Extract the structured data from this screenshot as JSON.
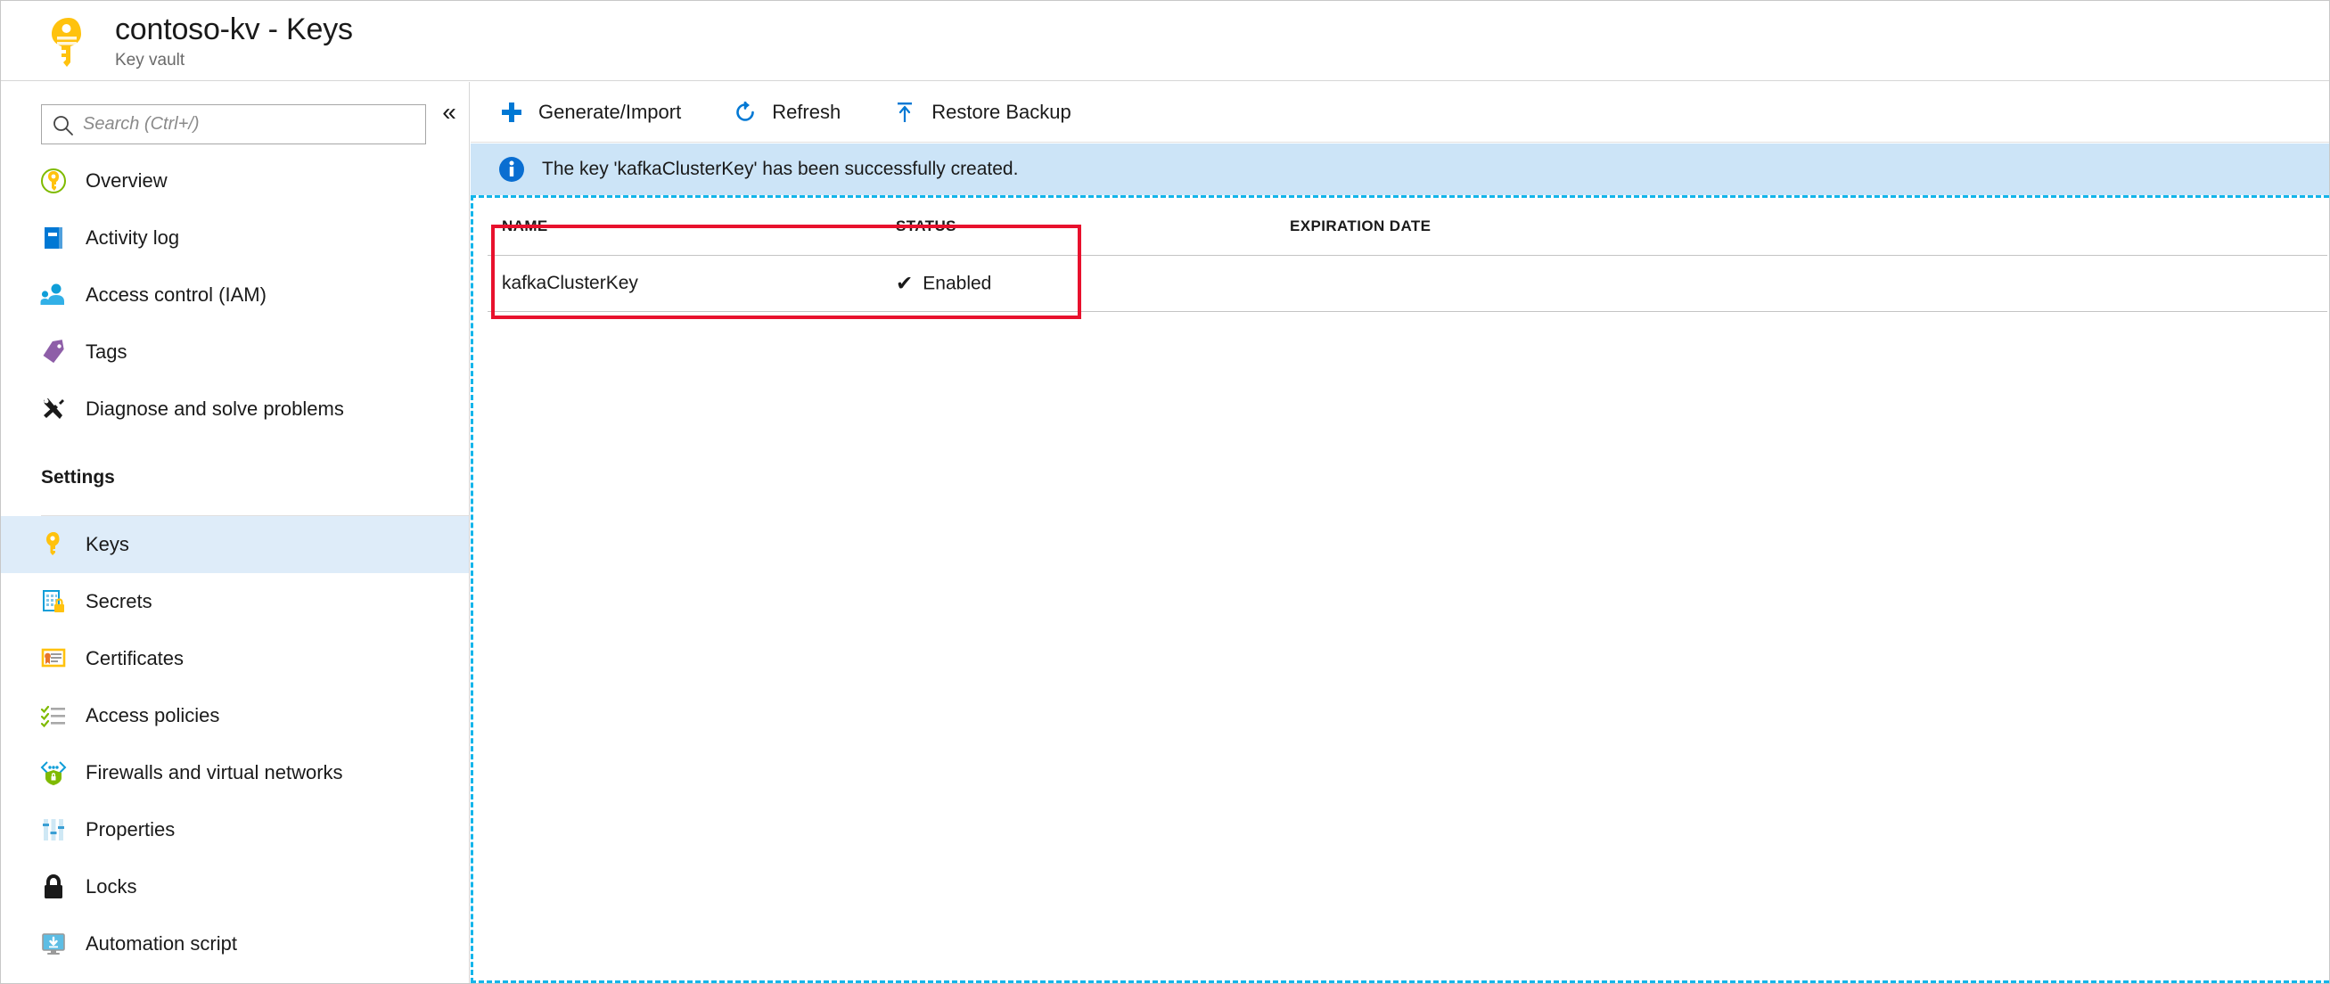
{
  "header": {
    "icon": "key-vault-icon",
    "title": "contoso-kv - Keys",
    "subtitle": "Key vault"
  },
  "sidebar": {
    "search": {
      "icon": "search-icon",
      "placeholder": "Search (Ctrl+/)",
      "value": ""
    },
    "collapse": {
      "icon": "chevron-double-left-icon",
      "glyph": "«"
    },
    "items": [
      {
        "label": "Overview",
        "icon": "overview-key-icon",
        "selected": false
      },
      {
        "label": "Activity log",
        "icon": "activity-log-icon",
        "selected": false
      },
      {
        "label": "Access control (IAM)",
        "icon": "access-control-icon",
        "selected": false
      },
      {
        "label": "Tags",
        "icon": "tags-icon",
        "selected": false
      },
      {
        "label": "Diagnose and solve problems",
        "icon": "diagnose-icon",
        "selected": false
      }
    ],
    "section_label": "Settings",
    "settings_items": [
      {
        "label": "Keys",
        "icon": "keys-icon",
        "selected": true
      },
      {
        "label": "Secrets",
        "icon": "secrets-icon",
        "selected": false
      },
      {
        "label": "Certificates",
        "icon": "certificates-icon",
        "selected": false
      },
      {
        "label": "Access policies",
        "icon": "access-policies-icon",
        "selected": false
      },
      {
        "label": "Firewalls and virtual networks",
        "icon": "firewall-icon",
        "selected": false
      },
      {
        "label": "Properties",
        "icon": "properties-icon",
        "selected": false
      },
      {
        "label": "Locks",
        "icon": "locks-icon",
        "selected": false
      },
      {
        "label": "Automation script",
        "icon": "automation-script-icon",
        "selected": false
      }
    ]
  },
  "toolbar": {
    "generate_import_label": "Generate/Import",
    "generate_import_icon": "plus-icon",
    "refresh_label": "Refresh",
    "refresh_icon": "refresh-icon",
    "restore_backup_label": "Restore Backup",
    "restore_backup_icon": "upload-arrow-icon"
  },
  "banner": {
    "icon": "info-icon",
    "message": "The key 'kafkaClusterKey' has been successfully created."
  },
  "table": {
    "columns": [
      "NAME",
      "STATUS",
      "EXPIRATION DATE"
    ],
    "rows": [
      {
        "name": "kafkaClusterKey",
        "status": "Enabled",
        "status_icon": "checkmark-icon",
        "status_glyph": "✔",
        "expiration_date": ""
      }
    ]
  },
  "annotation": {
    "name": "red-highlight-rectangle",
    "color": "#e8112d"
  },
  "colors": {
    "accent_blue": "#0078d4",
    "selected_row_bg": "#deecf9",
    "banner_bg": "#cce4f7",
    "key_yellow": "#ffc20e",
    "content_border": "#13b5ea",
    "annotation_red": "#e8112d"
  }
}
